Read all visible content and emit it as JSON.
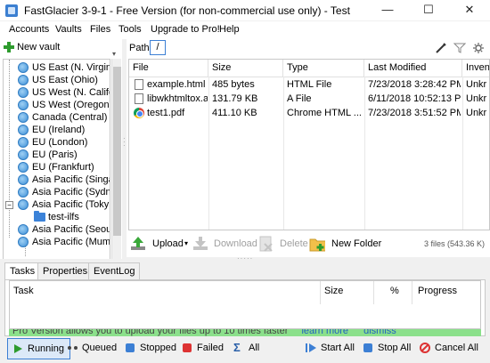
{
  "window": {
    "title": "FastGlacier 3-9-1 - Free Version (for non-commercial use only) - Test",
    "minimize_glyph": "—",
    "maximize_glyph": "☐",
    "close_glyph": "✕"
  },
  "menu": [
    "Accounts",
    "Vaults",
    "Files",
    "Tools",
    "Upgrade to Pro!",
    "Help"
  ],
  "left": {
    "new_vault_label": "New vault",
    "tree": [
      {
        "label": "US East (N. Virgini",
        "icon": "globe-icon"
      },
      {
        "label": "US East (Ohio)",
        "icon": "globe-icon"
      },
      {
        "label": "US West (N. Califo",
        "icon": "globe-icon"
      },
      {
        "label": "US West (Oregon)",
        "icon": "globe-icon"
      },
      {
        "label": "Canada (Central)",
        "icon": "globe-icon"
      },
      {
        "label": "EU (Ireland)",
        "icon": "globe-icon"
      },
      {
        "label": "EU (London)",
        "icon": "globe-icon"
      },
      {
        "label": "EU (Paris)",
        "icon": "globe-icon"
      },
      {
        "label": "EU (Frankfurt)",
        "icon": "globe-icon"
      },
      {
        "label": "Asia Pacific (Singa",
        "icon": "globe-icon"
      },
      {
        "label": "Asia Pacific (Sydn",
        "icon": "globe-icon"
      },
      {
        "label": "Asia Pacific (Toky",
        "icon": "globe-icon",
        "expanded": "−"
      },
      {
        "label": "test-ilfs",
        "icon": "folder-icon",
        "child": true
      },
      {
        "label": "Asia Pacific (Seou",
        "icon": "globe-icon"
      },
      {
        "label": "Asia Pacific (Mumb",
        "icon": "globe-icon"
      }
    ]
  },
  "path": {
    "label": "Path:",
    "value": "/"
  },
  "files": {
    "columns": [
      "File",
      "Size",
      "Type",
      "Last Modified",
      "Inven"
    ],
    "rows": [
      {
        "name": "example.html",
        "size": "485 bytes",
        "type": "HTML File",
        "modified": "7/23/2018 3:28:42 PM",
        "inventory": "Unkr",
        "icon": "document-icon"
      },
      {
        "name": "libwkhtmltox.a",
        "size": "131.79 KB",
        "type": "A File",
        "modified": "6/11/2018 10:52:13 PM",
        "inventory": "Unkr",
        "icon": "document-icon"
      },
      {
        "name": "test1.pdf",
        "size": "411.10 KB",
        "type": "Chrome HTML ...",
        "modified": "7/23/2018 3:51:52 PM",
        "inventory": "Unkr",
        "icon": "chrome-icon"
      }
    ]
  },
  "toolbar": {
    "upload": "Upload",
    "upload_arrow": "▾",
    "download": "Download",
    "delete": "Delete",
    "new_folder": "New Folder",
    "status": "3 files (543.36 K)"
  },
  "tabs": [
    "Tasks",
    "Properties",
    "EventLog"
  ],
  "tasks": {
    "columns": [
      "Task",
      "Size",
      "%",
      "Progress"
    ]
  },
  "promo": {
    "text": "Pro Version allows you to upload your files up to 10 times faster",
    "learn_more": "learn more",
    "dismiss": "dismiss"
  },
  "bottom": {
    "running": "Running",
    "queued": "Queued",
    "stopped": "Stopped",
    "failed": "Failed",
    "all": "All",
    "start_all": "Start All",
    "stop_all": "Stop All",
    "cancel_all": "Cancel All"
  },
  "colors": {
    "accent": "#3c7fd4",
    "promo_bg": "#8be08b",
    "green": "#2e9b2e"
  }
}
